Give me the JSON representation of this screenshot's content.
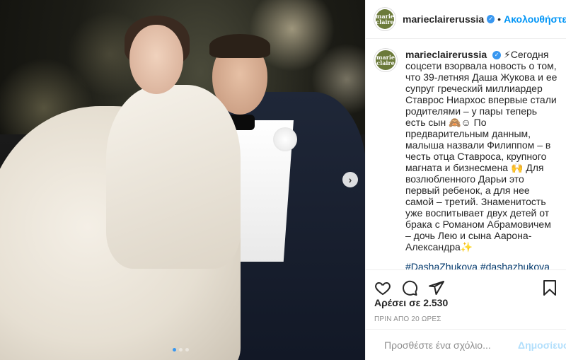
{
  "post": {
    "brand_logo_line1": "marie",
    "brand_logo_line2": "claire",
    "username": "marieclairerussia",
    "separator": "•",
    "follow_label": "Ακολουθήστε",
    "caption": "⚡Сегодня соцсети взорвала новость о том, что 39-летняя Даша Жукова и ее супруг греческий миллиардер Ставрос Ниархос впервые стали родителями – у пары теперь есть сын 🙈☺ По предварительным данным, малыша назвали Филиппом – в честь отца Ставроса, крупного магната и бизнесмена 🙌 Для возлюбленного Дарьи это первый ребенок, а для нее самой – третий. Знаменитость уже воспитывает двух детей от брака с Романом Абрамовичем – дочь Лею и сына Аарона-Александра✨",
    "hashtags": "#DashaZhukova #dashazhukova #zhukova #StavrosNiarchos #stavrosniarchos #dashaandstavros",
    "likes_text": "Αρέσει σε 2.530",
    "time_text": "ΠΡΙΝ ΑΠΟ 20 ΩΡΕΣ",
    "comment_placeholder": "Προσθέστε ένα σχόλιο...",
    "publish_label": "Δημοσίευση",
    "carousel_next": "›"
  },
  "icons": {
    "like": "heart-icon",
    "comment": "comment-icon",
    "share": "paper-plane-icon",
    "save": "bookmark-icon",
    "emoji": "smiley-icon",
    "verified": "verified-badge-icon"
  },
  "colors": {
    "link_blue": "#0095f6",
    "hashtag": "#00376b",
    "muted": "#8e8e8e",
    "publish_disabled": "#b2dffc",
    "active_dot": "#3897f0"
  }
}
